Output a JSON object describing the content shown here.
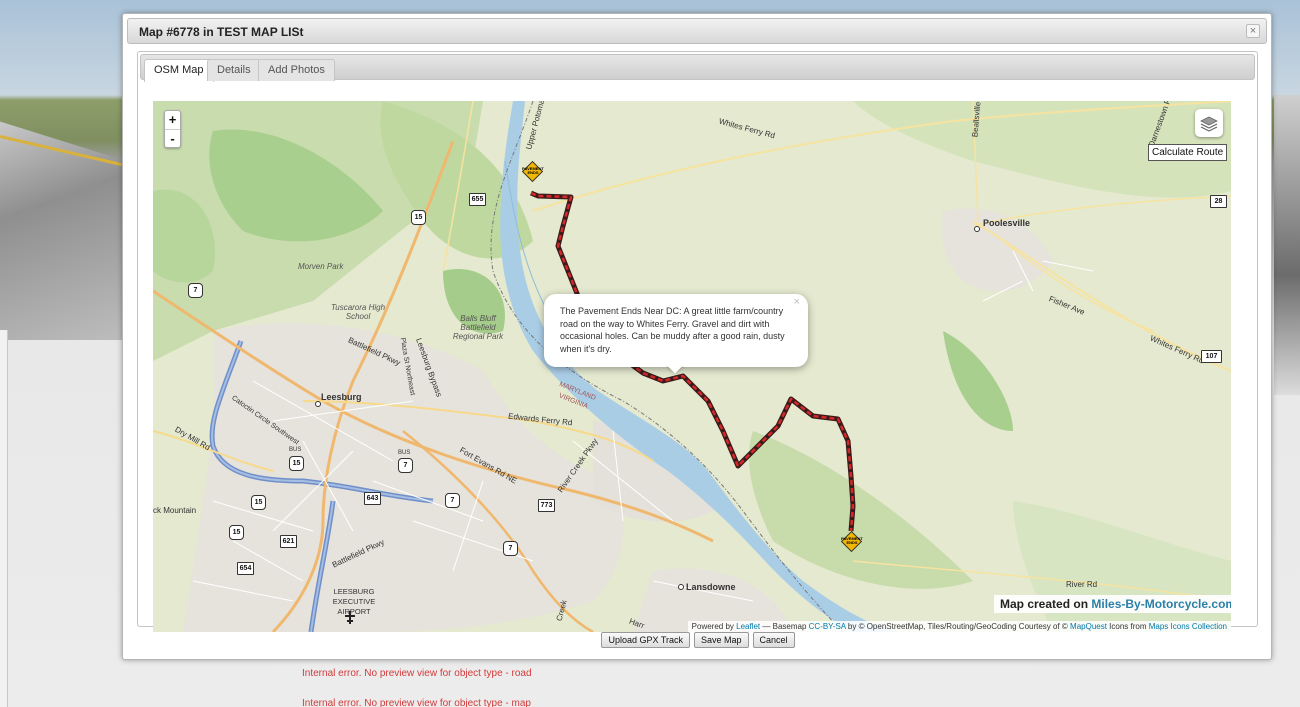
{
  "dialog": {
    "title": "Map #6778 in TEST MAP LISt",
    "close_glyph": "×"
  },
  "tabs": [
    {
      "label": "OSM Map",
      "active": true
    },
    {
      "label": "Details",
      "active": false
    },
    {
      "label": "Add Photos",
      "active": false
    }
  ],
  "map": {
    "zoom_in": "+",
    "zoom_out": "-",
    "layers_icon": "layers-icon",
    "calculate_route": "Calculate Route",
    "popup": {
      "text": "The Pavement Ends Near DC: A great little farm/country road on the way to Whites Ferry. Gravel and dirt with occasional holes. Can be muddy after a good rain, dusty when it's dry.",
      "close": "×"
    },
    "marker_sign_text": "PAVEMENT ENDS",
    "created_prefix": "Map created on ",
    "created_brand": "Miles-By-Motorcycle.com",
    "attribution": {
      "powered_by": "Powered by ",
      "leaflet": "Leaflet",
      "basemap": " — Basemap ",
      "license": "CC-BY-SA",
      "osm": " by © OpenStreetMap, Tiles/Routing/GeoCoding Courtesy of © ",
      "mapquest": "MapQuest",
      "icons": " Icons from ",
      "icons_link": "Maps Icons Collection"
    },
    "places": {
      "leesburg": "Leesburg",
      "poolesville": "Poolesville",
      "lansdowne": "Lansdowne",
      "morven_park": "Morven Park",
      "tuscarora": "Tuscarora High School",
      "balls_bluff": "Balls Bluff Battlefield Regional Park",
      "airport": "LEESBURG EXECUTIVE AIRPORT",
      "maryland": "MARYLAND",
      "virginia": "VIRGINIA",
      "black_mountain": "ck Mountain"
    },
    "roads": {
      "whites_ferry_rd_top": "Whites Ferry Rd",
      "whites_ferry_rd_right": "Whites Ferry Rd",
      "fisher_ave": "Fisher Ave",
      "edwards_ferry_rd": "Edwards Ferry Rd",
      "fort_evans_rd": "Fort Evans Rd NE",
      "river_creek_pkwy": "River Creek Pkwy",
      "river_rd": "River Rd",
      "battlefield_pkwy": "Battlefield Pkwy",
      "leesburg_bypass": "Leesburg Bypass",
      "catoctin_circle": "Catoctin Circle Southwest",
      "dry_mill_rd": "Dry Mill Rd",
      "upper_potomac": "Upper Potomac",
      "beallsville": "Beallsville R",
      "darnestown_rd": "Darnestown Rd",
      "plaza_st": "Plaza St Northeast",
      "harr": "Harr",
      "creek": "Creek"
    },
    "shields": [
      "655",
      "15",
      "7",
      "15",
      "7",
      "7",
      "773",
      "7",
      "643",
      "15",
      "15",
      "621",
      "654",
      "28",
      "107"
    ],
    "bus_label": "BUS"
  },
  "buttons": {
    "upload": "Upload GPX Track",
    "save": "Save Map",
    "cancel": "Cancel"
  },
  "errors": [
    "Internal error. No preview view for object type - road",
    "Internal error. No preview view for object type - map"
  ],
  "colors": {
    "route": "#d62828",
    "river": "#aacde6",
    "brand": "#2a7fa8",
    "error": "#d23b3b"
  }
}
